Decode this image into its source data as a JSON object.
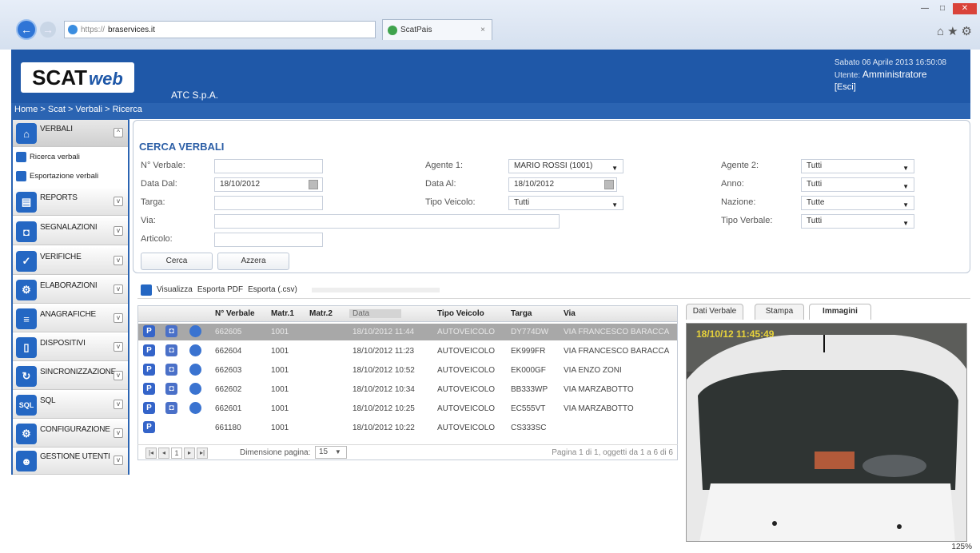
{
  "browser": {
    "address_prefix": "https://",
    "address_domain": "braservices.it",
    "tab_title": "ScatPais",
    "zoom": "125%"
  },
  "header": {
    "logo_scat": "SCAT",
    "logo_web": "web",
    "company": "ATC S.p.A.",
    "date": "Sabato 06 Aprile 2013 16:50:08",
    "user_label": "Utente:",
    "user_name": "Amministratore",
    "exit": "[Esci]"
  },
  "breadcrumb": "Home > Scat > Verbali > Ricerca",
  "sidebar": {
    "verbali": "VERBALI",
    "sub1": "Ricerca verbali",
    "sub2": "Esportazione verbali",
    "items": [
      "REPORTS",
      "SEGNALAZIONI",
      "VERIFICHE",
      "ELABORAZIONI",
      "ANAGRAFICHE",
      "DISPOSITIVI",
      "SINCRONIZZAZIONE",
      "SQL",
      "CONFIGURAZIONE",
      "GESTIONE UTENTI"
    ]
  },
  "search": {
    "title": "CERCA VERBALI",
    "n_verbale_label": "N° Verbale:",
    "data_dal_label": "Data Dal:",
    "data_dal_value": "18/10/2012",
    "targa_label": "Targa:",
    "via_label": "Via:",
    "articolo_label": "Articolo:",
    "agente1_label": "Agente 1:",
    "agente1_value": "MARIO ROSSI (1001)",
    "data_al_label": "Data Al:",
    "data_al_value": "18/10/2012",
    "tipo_veicolo_label": "Tipo Veicolo:",
    "tipo_veicolo_value": "Tutti",
    "agente2_label": "Agente 2:",
    "agente2_value": "Tutti",
    "anno_label": "Anno:",
    "anno_value": "Tutti",
    "nazione_label": "Nazione:",
    "nazione_value": "Tutte",
    "tipo_verbale_label": "Tipo Verbale:",
    "tipo_verbale_value": "Tutti",
    "cerca": "Cerca",
    "azzera": "Azzera"
  },
  "toolbar": {
    "visualizza": "Visualizza",
    "pdf": "Esporta PDF",
    "csv": "Esporta (.csv)"
  },
  "grid": {
    "headers": [
      "N° Verbale",
      "Matr.1",
      "Matr.2",
      "Data",
      "Tipo Veicolo",
      "Targa",
      "Via"
    ],
    "rows": [
      {
        "num": "662605",
        "matr1": "1001",
        "data": "18/10/2012 11:44",
        "tipo": "AUTOVEICOLO",
        "targa": "DY774DW",
        "via": "VIA FRANCESCO BARACCA"
      },
      {
        "num": "662604",
        "matr1": "1001",
        "data": "18/10/2012 11:23",
        "tipo": "AUTOVEICOLO",
        "targa": "EK999FR",
        "via": "VIA FRANCESCO BARACCA"
      },
      {
        "num": "662603",
        "matr1": "1001",
        "data": "18/10/2012 10:52",
        "tipo": "AUTOVEICOLO",
        "targa": "EK000GF",
        "via": "VIA ENZO ZONI"
      },
      {
        "num": "662602",
        "matr1": "1001",
        "data": "18/10/2012 10:34",
        "tipo": "AUTOVEICOLO",
        "targa": "BB333WP",
        "via": "VIA MARZABOTTO"
      },
      {
        "num": "662601",
        "matr1": "1001",
        "data": "18/10/2012 10:25",
        "tipo": "AUTOVEICOLO",
        "targa": "EC555VT",
        "via": "VIA MARZABOTTO"
      },
      {
        "num": "661180",
        "matr1": "1001",
        "data": "18/10/2012 10:22",
        "tipo": "AUTOVEICOLO",
        "targa": "CS333SC",
        "via": ""
      }
    ],
    "page_size_label": "Dimensione pagina:",
    "page_size": "15",
    "page_current": "1",
    "pager_info": "Pagina 1 di 1, oggetti da 1 a 6 di 6"
  },
  "detail": {
    "tabs": [
      "Dati Verbale",
      "Stampa",
      "Immagini"
    ],
    "photo_timestamp": "18/10/12 11:45:49"
  }
}
